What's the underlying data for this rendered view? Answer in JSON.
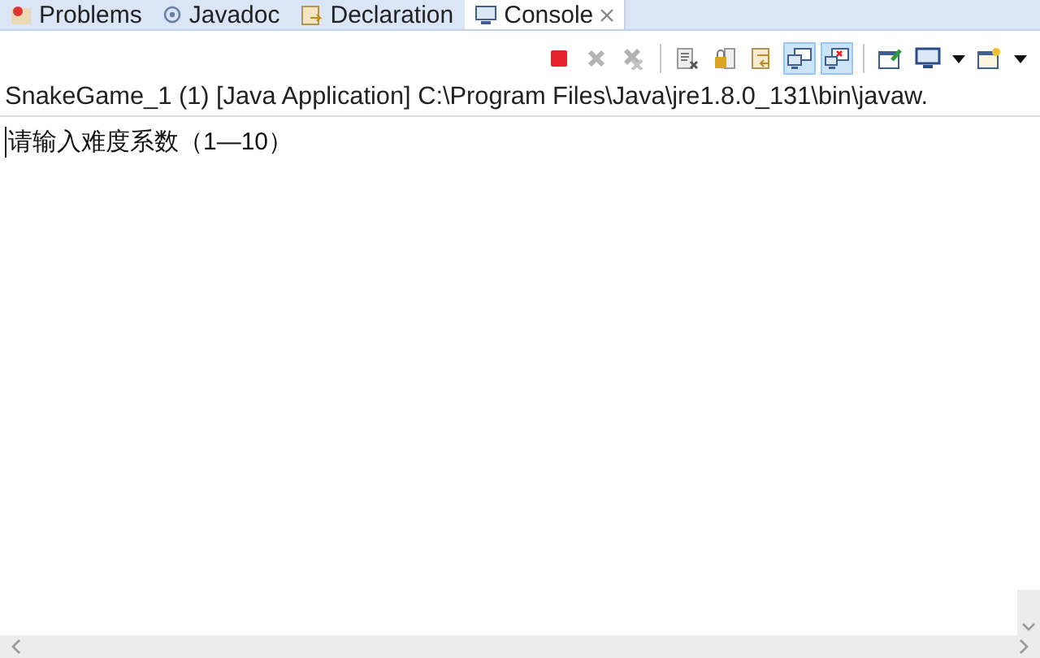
{
  "tabs": [
    {
      "label": "Problems",
      "kind": "problems",
      "selected": false
    },
    {
      "label": "Javadoc",
      "kind": "javadoc",
      "selected": false
    },
    {
      "label": "Declaration",
      "kind": "declaration",
      "selected": false
    },
    {
      "label": "Console",
      "kind": "console",
      "selected": true
    }
  ],
  "toolbar": [
    [
      {
        "kind": "terminate",
        "on": false,
        "disabled": false
      },
      {
        "kind": "remove",
        "on": false,
        "disabled": true
      },
      {
        "kind": "remove-all",
        "on": false,
        "disabled": true
      }
    ],
    [
      {
        "kind": "clear",
        "on": false,
        "disabled": false
      },
      {
        "kind": "scroll-lock",
        "on": false,
        "disabled": false
      },
      {
        "kind": "word-wrap",
        "on": false,
        "disabled": false
      },
      {
        "kind": "show-out",
        "on": true,
        "disabled": false
      },
      {
        "kind": "show-err",
        "on": true,
        "disabled": false
      }
    ],
    [
      {
        "kind": "pin",
        "on": false,
        "disabled": false
      },
      {
        "kind": "display",
        "on": false,
        "disabled": false
      },
      {
        "kind": "dropdown",
        "on": false,
        "disabled": false
      },
      {
        "kind": "open",
        "on": false,
        "disabled": false
      },
      {
        "kind": "dropdown",
        "on": false,
        "disabled": false
      }
    ]
  ],
  "console": {
    "title": "SnakeGame_1 (1) [Java Application] C:\\Program Files\\Java\\jre1.8.0_131\\bin\\javaw.",
    "lines": [
      "请输入难度系数（1—10）"
    ]
  }
}
